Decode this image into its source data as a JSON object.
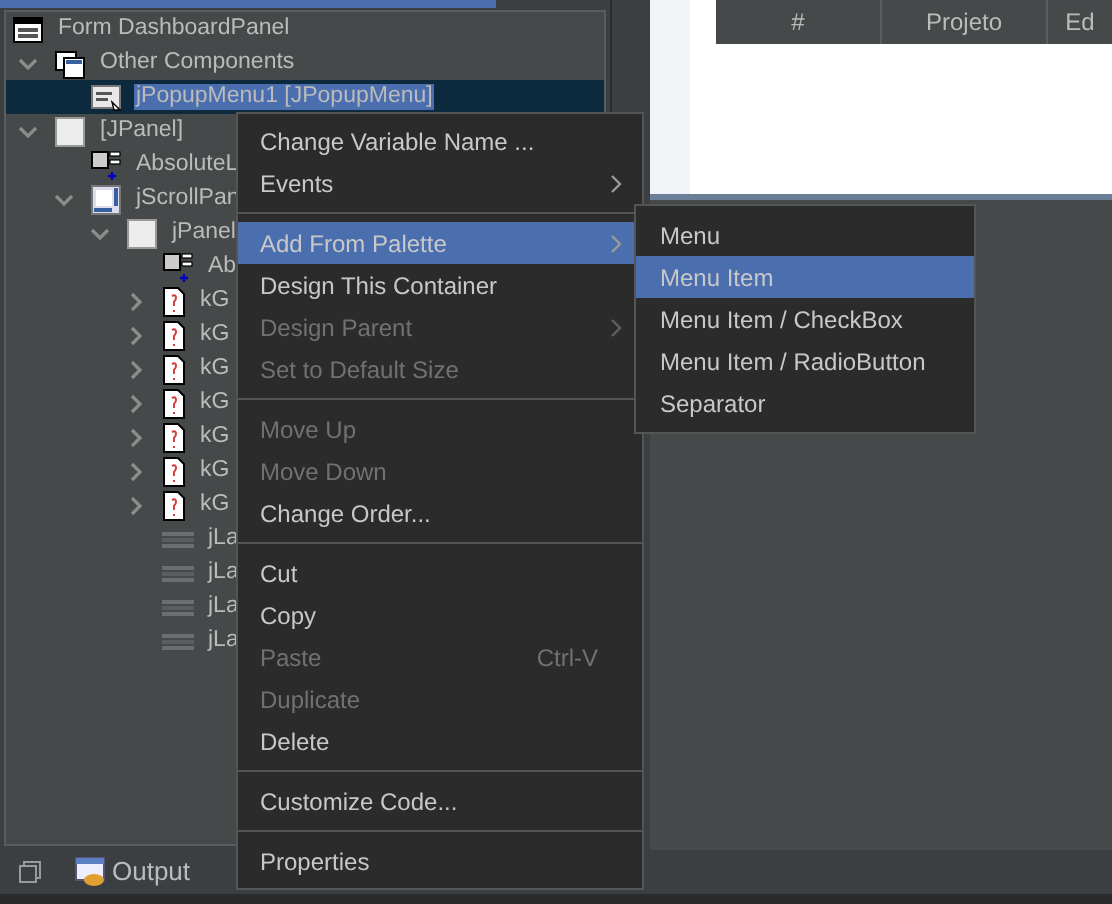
{
  "tree": {
    "label": "Form DashboardPanel",
    "kind": "form",
    "selected": false,
    "children": [
      {
        "label": "Other Components",
        "kind": "components",
        "expanded": true,
        "selected": false,
        "children": [
          {
            "label": "jPopupMenu1 [JPopupMenu]",
            "kind": "popup",
            "selected": true
          }
        ]
      },
      {
        "label": "[JPanel]",
        "kind": "panel",
        "expanded": true,
        "selected": false,
        "children": [
          {
            "label": "AbsoluteL",
            "kind": "absolute",
            "selected": false
          },
          {
            "label": "jScrollPan",
            "kind": "scroll",
            "expanded": true,
            "selected": false,
            "children": [
              {
                "label": "jPanel",
                "kind": "panel",
                "expanded": true,
                "selected": false,
                "children": [
                  {
                    "label": "Ab",
                    "kind": "absolute",
                    "selected": false
                  },
                  {
                    "label": "kG",
                    "kind": "file",
                    "expanded": false,
                    "selected": false
                  },
                  {
                    "label": "kG",
                    "kind": "file",
                    "expanded": false,
                    "selected": false
                  },
                  {
                    "label": "kG",
                    "kind": "file",
                    "expanded": false,
                    "selected": false
                  },
                  {
                    "label": "kG",
                    "kind": "file",
                    "expanded": false,
                    "selected": false
                  },
                  {
                    "label": "kG",
                    "kind": "file",
                    "expanded": false,
                    "selected": false
                  },
                  {
                    "label": "kG",
                    "kind": "file",
                    "expanded": false,
                    "selected": false
                  },
                  {
                    "label": "kG",
                    "kind": "file",
                    "expanded": false,
                    "selected": false
                  },
                  {
                    "label": "jLa",
                    "kind": "label",
                    "selected": false
                  },
                  {
                    "label": "jLa",
                    "kind": "label",
                    "selected": false
                  },
                  {
                    "label": "jLa",
                    "kind": "label",
                    "selected": false
                  },
                  {
                    "label": "jLa",
                    "kind": "label",
                    "selected": false
                  }
                ]
              }
            ]
          }
        ]
      }
    ]
  },
  "table": {
    "columns": [
      "#",
      "Projeto",
      "Ed"
    ]
  },
  "context_menu": [
    {
      "kind": "item",
      "label": "Change Variable Name ...",
      "disabled": false,
      "submenu": false,
      "selected": false
    },
    {
      "kind": "item",
      "label": "Events",
      "disabled": false,
      "submenu": true,
      "selected": false
    },
    {
      "kind": "separator"
    },
    {
      "kind": "item",
      "label": "Add From Palette",
      "disabled": false,
      "submenu": true,
      "selected": true
    },
    {
      "kind": "item",
      "label": "Design This Container",
      "disabled": false,
      "submenu": false,
      "selected": false
    },
    {
      "kind": "item",
      "label": "Design Parent",
      "disabled": true,
      "submenu": true,
      "selected": false
    },
    {
      "kind": "item",
      "label": "Set to Default Size",
      "disabled": true,
      "submenu": false,
      "selected": false
    },
    {
      "kind": "separator"
    },
    {
      "kind": "item",
      "label": "Move Up",
      "disabled": true,
      "submenu": false,
      "selected": false
    },
    {
      "kind": "item",
      "label": "Move Down",
      "disabled": true,
      "submenu": false,
      "selected": false
    },
    {
      "kind": "item",
      "label": "Change Order...",
      "disabled": false,
      "submenu": false,
      "selected": false
    },
    {
      "kind": "separator"
    },
    {
      "kind": "item",
      "label": "Cut",
      "disabled": false,
      "submenu": false,
      "selected": false
    },
    {
      "kind": "item",
      "label": "Copy",
      "disabled": false,
      "submenu": false,
      "selected": false
    },
    {
      "kind": "item",
      "label": "Paste",
      "shortcut": "Ctrl-V",
      "disabled": true,
      "submenu": false,
      "selected": false
    },
    {
      "kind": "item",
      "label": "Duplicate",
      "disabled": true,
      "submenu": false,
      "selected": false
    },
    {
      "kind": "item",
      "label": "Delete",
      "disabled": false,
      "submenu": false,
      "selected": false
    },
    {
      "kind": "separator"
    },
    {
      "kind": "item",
      "label": "Customize Code...",
      "disabled": false,
      "submenu": false,
      "selected": false
    },
    {
      "kind": "separator"
    },
    {
      "kind": "item",
      "label": "Properties",
      "disabled": false,
      "submenu": false,
      "selected": false
    }
  ],
  "submenu": [
    {
      "label": "Menu",
      "selected": false
    },
    {
      "label": "Menu Item",
      "selected": true
    },
    {
      "label": "Menu Item / CheckBox",
      "selected": false
    },
    {
      "label": "Menu Item / RadioButton",
      "selected": false
    },
    {
      "label": "Separator",
      "selected": false
    }
  ],
  "bottom_tabs": [
    {
      "label": "Output"
    }
  ]
}
